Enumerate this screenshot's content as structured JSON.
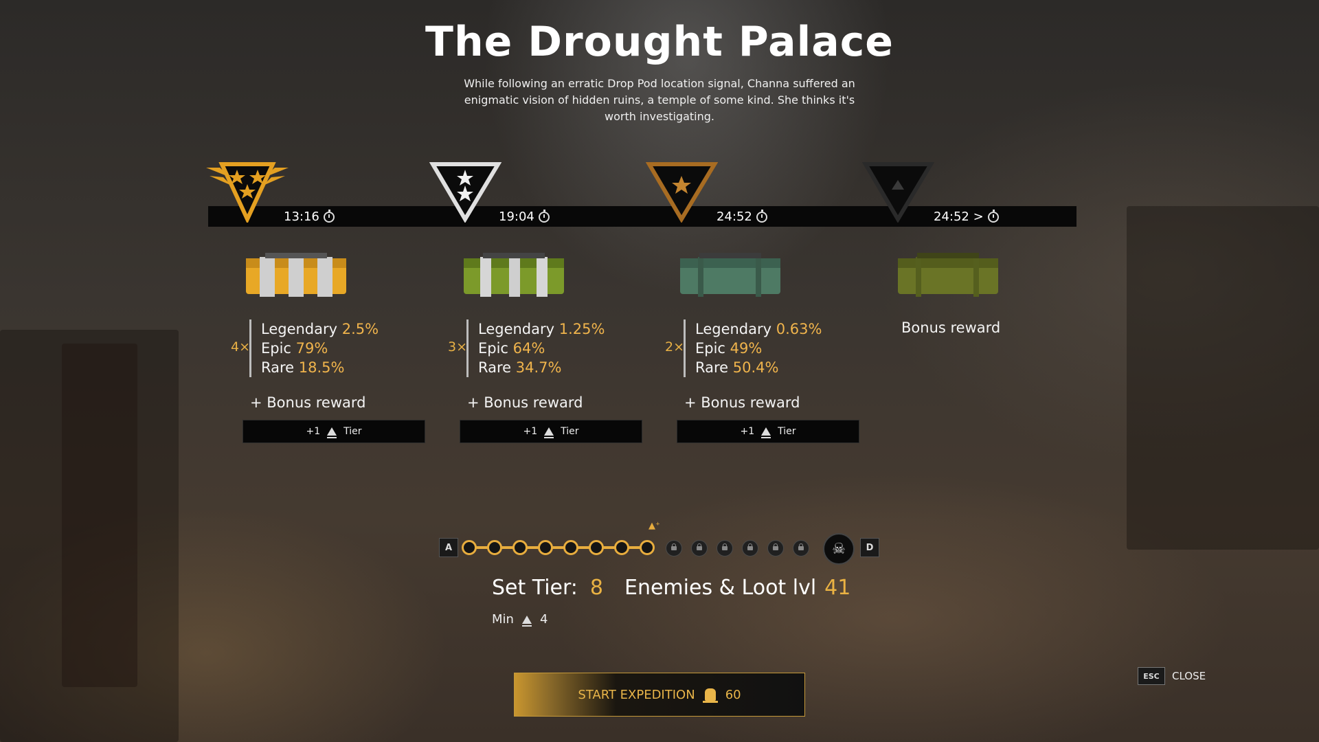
{
  "title": "The Drought Palace",
  "description": "While following an erratic Drop Pod location signal, Channa suffered an enigmatic vision of hidden ruins, a temple of some kind. She thinks it's worth investigating.",
  "tiers": [
    {
      "rank": "gold",
      "time": "13:16",
      "multiplier": "4×",
      "legendary_label": "Legendary",
      "legendary": "2.5%",
      "epic_label": "Epic",
      "epic": "79%",
      "rare_label": "Rare",
      "rare": "18.5%",
      "bonus": "+ Bonus reward",
      "tier_bonus": "+1",
      "tier_label": "Tier",
      "chest_color": "#e8a826"
    },
    {
      "rank": "silver",
      "time": "19:04",
      "multiplier": "3×",
      "legendary_label": "Legendary",
      "legendary": "1.25%",
      "epic_label": "Epic",
      "epic": "64%",
      "rare_label": "Rare",
      "rare": "34.7%",
      "bonus": "+ Bonus reward",
      "tier_bonus": "+1",
      "tier_label": "Tier",
      "chest_color": "#7c9a2a"
    },
    {
      "rank": "bronze",
      "time": "24:52",
      "multiplier": "2×",
      "legendary_label": "Legendary",
      "legendary": "0.63%",
      "epic_label": "Epic",
      "epic": "49%",
      "rare_label": "Rare",
      "rare": "50.4%",
      "bonus": "+ Bonus reward",
      "tier_bonus": "+1",
      "tier_label": "Tier",
      "chest_color": "#4e7a64"
    },
    {
      "rank": "none",
      "time": "24:52 >",
      "reward": "Bonus reward",
      "chest_color": "#6a7426"
    }
  ],
  "tier_track": {
    "start_label": "A",
    "end_label": "D",
    "unlocked": 8,
    "locked": 6
  },
  "set_tier_label": "Set Tier:",
  "set_tier_value": "8",
  "enemies_label": "Enemies & Loot lvl",
  "enemies_value": "41",
  "min_label": "Min",
  "min_value": "4",
  "start_button": {
    "label": "START EXPEDITION",
    "cost": "60"
  },
  "close": {
    "key": "ESC",
    "label": "CLOSE"
  }
}
